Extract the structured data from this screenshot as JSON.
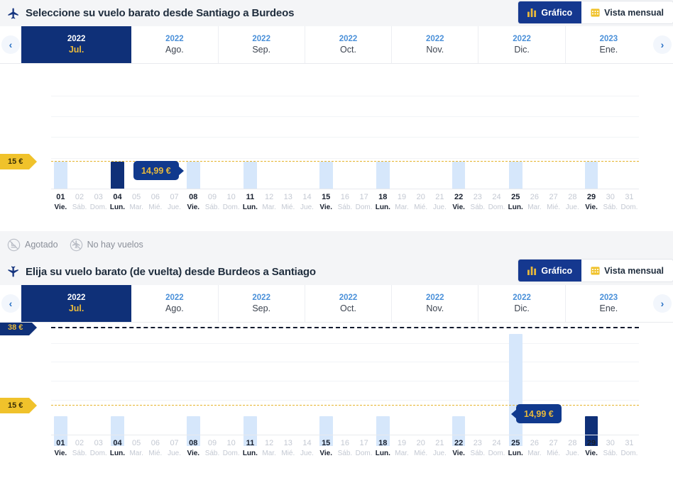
{
  "outbound": {
    "title": "Seleccione su vuelo barato desde Santiago a Burdeos",
    "plane_icon": "plane-icon",
    "toolbar": {
      "chart_label": "Gráfico",
      "chart_icon": "bar-chart-icon",
      "month_label": "Vista mensual",
      "month_icon": "calendar-icon"
    },
    "nav": {
      "prev": "‹",
      "next": "›"
    },
    "months": [
      {
        "year": "2022",
        "name": "Jul.",
        "selected": true
      },
      {
        "year": "2022",
        "name": "Ago.",
        "selected": false
      },
      {
        "year": "2022",
        "name": "Sep.",
        "selected": false
      },
      {
        "year": "2022",
        "name": "Oct.",
        "selected": false
      },
      {
        "year": "2022",
        "name": "Nov.",
        "selected": false
      },
      {
        "year": "2022",
        "name": "Dic.",
        "selected": false
      },
      {
        "year": "2023",
        "name": "Ene.",
        "selected": false
      }
    ],
    "tooltip": "14,99 €"
  },
  "return": {
    "title": "Elija su vuelo barato (de vuelta) desde Burdeos a Santiago",
    "plane_icon": "plane-return-icon",
    "toolbar": {
      "chart_label": "Gráfico",
      "chart_icon": "bar-chart-icon",
      "month_label": "Vista mensual",
      "month_icon": "calendar-icon"
    },
    "nav": {
      "prev": "‹",
      "next": "›"
    },
    "months": [
      {
        "year": "2022",
        "name": "Jul.",
        "selected": true
      },
      {
        "year": "2022",
        "name": "Ago.",
        "selected": false
      },
      {
        "year": "2022",
        "name": "Sep.",
        "selected": false
      },
      {
        "year": "2022",
        "name": "Oct.",
        "selected": false
      },
      {
        "year": "2022",
        "name": "Nov.",
        "selected": false
      },
      {
        "year": "2022",
        "name": "Dic.",
        "selected": false
      },
      {
        "year": "2023",
        "name": "Ene.",
        "selected": false
      }
    ],
    "tooltip": "14,99 €"
  },
  "legend": {
    "items": [
      {
        "label": "Agotado",
        "icon": "sold-out-icon"
      },
      {
        "label": "No hay vuelos",
        "icon": "no-flights-icon"
      }
    ]
  },
  "colors": {
    "brand_blue": "#0f3078",
    "accent_gold": "#f0c22b",
    "bar_fill": "#d6e7fb",
    "header_bg": "#f4f5f7"
  },
  "chart_data": [
    {
      "id": "outbound",
      "type": "bar",
      "title": "Seleccione su vuelo barato desde Santiago a Burdeos",
      "xlabel": "",
      "ylabel": "",
      "ylim": [
        0,
        38
      ],
      "grid": true,
      "legend_position": "below",
      "price_levels": [
        {
          "label": "15 €",
          "value": 15,
          "style": "gold"
        }
      ],
      "annotations": [
        {
          "text": "14,99 €",
          "at_category": "04",
          "side": "right"
        }
      ],
      "categories": [
        "01",
        "02",
        "03",
        "04",
        "05",
        "06",
        "07",
        "08",
        "09",
        "10",
        "11",
        "12",
        "13",
        "14",
        "15",
        "16",
        "17",
        "18",
        "19",
        "20",
        "21",
        "22",
        "23",
        "24",
        "25",
        "26",
        "27",
        "28",
        "29",
        "30",
        "31"
      ],
      "weekdays": [
        "Vie.",
        "Sáb.",
        "Dom.",
        "Lun.",
        "Mar.",
        "Mié.",
        "Jue.",
        "Vie.",
        "Sáb.",
        "Dom.",
        "Lun.",
        "Mar.",
        "Mié.",
        "Jue.",
        "Vie.",
        "Sáb.",
        "Dom.",
        "Lun.",
        "Mar.",
        "Mié.",
        "Jue.",
        "Vie.",
        "Sáb.",
        "Dom.",
        "Lun.",
        "Mar.",
        "Mié.",
        "Jue.",
        "Vie.",
        "Sáb.",
        "Dom."
      ],
      "values": [
        15,
        null,
        null,
        15,
        null,
        null,
        null,
        15,
        null,
        null,
        15,
        null,
        null,
        null,
        15,
        null,
        null,
        15,
        null,
        null,
        null,
        15,
        null,
        null,
        15,
        null,
        null,
        null,
        15,
        null,
        null
      ],
      "selected_category": "04",
      "active_categories": [
        "01",
        "04",
        "08",
        "11",
        "15",
        "18",
        "22",
        "25",
        "29"
      ]
    },
    {
      "id": "return",
      "type": "bar",
      "title": "Elija su vuelo barato (de vuelta) desde Burdeos a Santiago",
      "xlabel": "",
      "ylabel": "",
      "ylim": [
        0,
        38
      ],
      "grid": true,
      "legend_position": "none",
      "price_levels": [
        {
          "label": "38 €",
          "value": 38,
          "style": "blue"
        },
        {
          "label": "15 €",
          "value": 15,
          "style": "gold"
        }
      ],
      "annotations": [
        {
          "text": "14,99 €",
          "at_category": "29",
          "side": "left"
        }
      ],
      "categories": [
        "01",
        "02",
        "03",
        "04",
        "05",
        "06",
        "07",
        "08",
        "09",
        "10",
        "11",
        "12",
        "13",
        "14",
        "15",
        "16",
        "17",
        "18",
        "19",
        "20",
        "21",
        "22",
        "23",
        "24",
        "25",
        "26",
        "27",
        "28",
        "29",
        "30",
        "31"
      ],
      "weekdays": [
        "Vie.",
        "Sáb.",
        "Dom.",
        "Lun.",
        "Mar.",
        "Mié.",
        "Jue.",
        "Vie.",
        "Sáb.",
        "Dom.",
        "Lun.",
        "Mar.",
        "Mié.",
        "Jue.",
        "Vie.",
        "Sáb.",
        "Dom.",
        "Lun.",
        "Mar.",
        "Mié.",
        "Jue.",
        "Vie.",
        "Sáb.",
        "Dom.",
        "Lun.",
        "Mar.",
        "Mié.",
        "Jue.",
        "Vie.",
        "Sáb.",
        "Dom."
      ],
      "values": [
        15,
        null,
        null,
        15,
        null,
        null,
        null,
        15,
        null,
        null,
        15,
        null,
        null,
        null,
        15,
        null,
        null,
        15,
        null,
        null,
        null,
        15,
        null,
        null,
        38,
        null,
        null,
        null,
        15,
        null,
        null
      ],
      "selected_category": "29",
      "active_categories": [
        "01",
        "04",
        "08",
        "11",
        "15",
        "18",
        "22",
        "25",
        "29"
      ]
    }
  ]
}
